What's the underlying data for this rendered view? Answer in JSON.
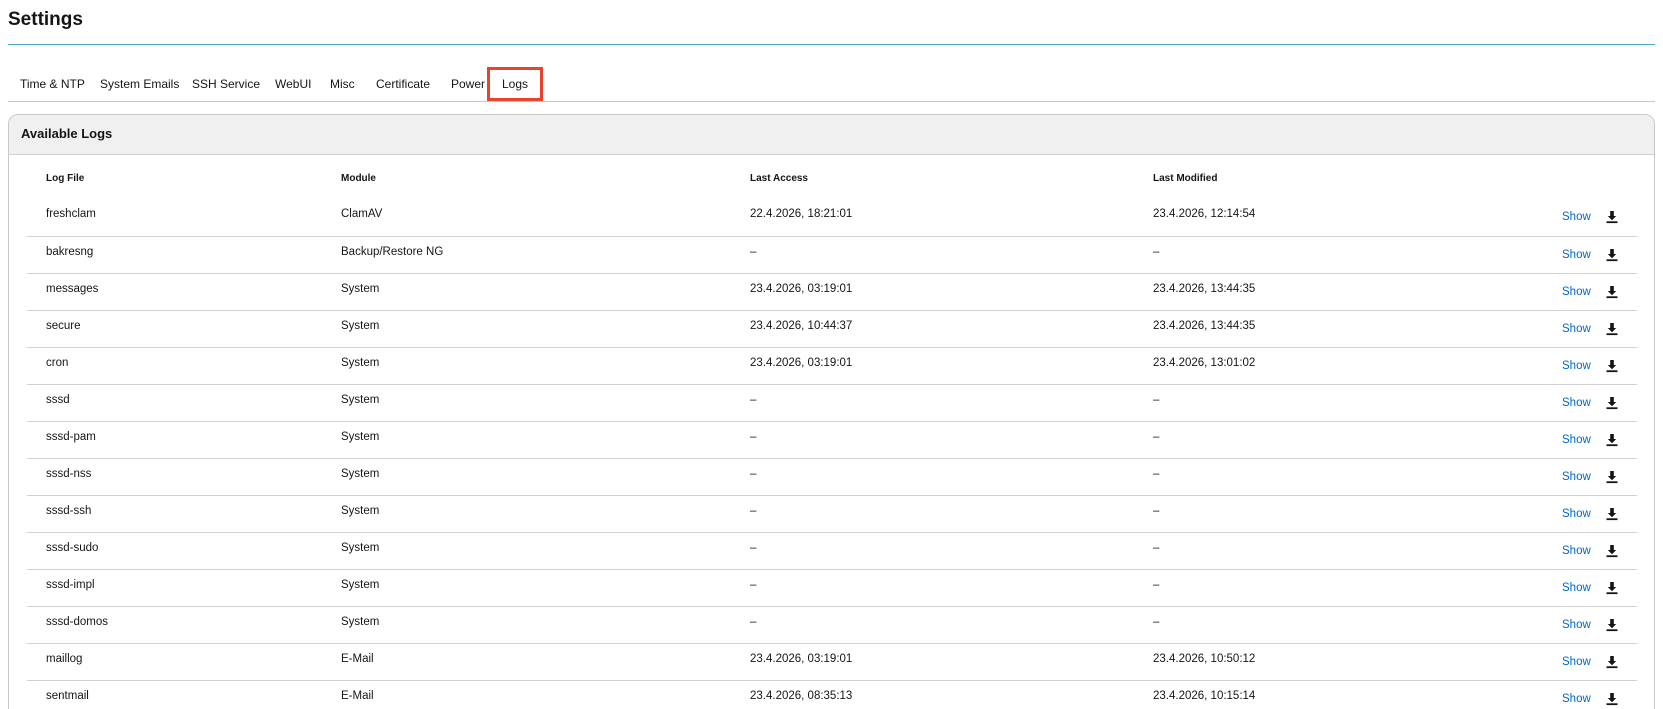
{
  "page": {
    "title": "Settings"
  },
  "tabs": [
    {
      "label": "Time & NTP"
    },
    {
      "label": "System Emails"
    },
    {
      "label": "SSH Service"
    },
    {
      "label": "WebUI"
    },
    {
      "label": "Misc"
    },
    {
      "label": "Certificate"
    },
    {
      "label": "Power"
    },
    {
      "label": "Logs",
      "active": true
    }
  ],
  "card": {
    "title": "Available Logs",
    "columns": [
      "Log File",
      "Module",
      "Last Access",
      "Last Modified"
    ],
    "action_label": "Show",
    "rows": [
      {
        "file": "freshclam",
        "module": "ClamAV",
        "access": "22.4.2026, 18:21:01",
        "modified": "23.4.2026, 12:14:54"
      },
      {
        "file": "bakresng",
        "module": "Backup/Restore NG",
        "access": "–",
        "modified": "–"
      },
      {
        "file": "messages",
        "module": "System",
        "access": "23.4.2026, 03:19:01",
        "modified": "23.4.2026, 13:44:35"
      },
      {
        "file": "secure",
        "module": "System",
        "access": "23.4.2026, 10:44:37",
        "modified": "23.4.2026, 13:44:35"
      },
      {
        "file": "cron",
        "module": "System",
        "access": "23.4.2026, 03:19:01",
        "modified": "23.4.2026, 13:01:02"
      },
      {
        "file": "sssd",
        "module": "System",
        "access": "–",
        "modified": "–"
      },
      {
        "file": "sssd-pam",
        "module": "System",
        "access": "–",
        "modified": "–"
      },
      {
        "file": "sssd-nss",
        "module": "System",
        "access": "–",
        "modified": "–"
      },
      {
        "file": "sssd-ssh",
        "module": "System",
        "access": "–",
        "modified": "–"
      },
      {
        "file": "sssd-sudo",
        "module": "System",
        "access": "–",
        "modified": "–"
      },
      {
        "file": "sssd-impl",
        "module": "System",
        "access": "–",
        "modified": "–"
      },
      {
        "file": "sssd-domos",
        "module": "System",
        "access": "–",
        "modified": "–"
      },
      {
        "file": "maillog",
        "module": "E-Mail",
        "access": "23.4.2026, 03:19:01",
        "modified": "23.4.2026, 10:50:12"
      },
      {
        "file": "sentmail",
        "module": "E-Mail",
        "access": "23.4.2026, 08:35:13",
        "modified": "23.4.2026, 10:15:14"
      }
    ]
  },
  "icons": {
    "download": "download-icon"
  },
  "colors": {
    "link": "#0066cc",
    "active_tab_outline": "#e8432f",
    "title_rule": "#4aa8c4"
  }
}
